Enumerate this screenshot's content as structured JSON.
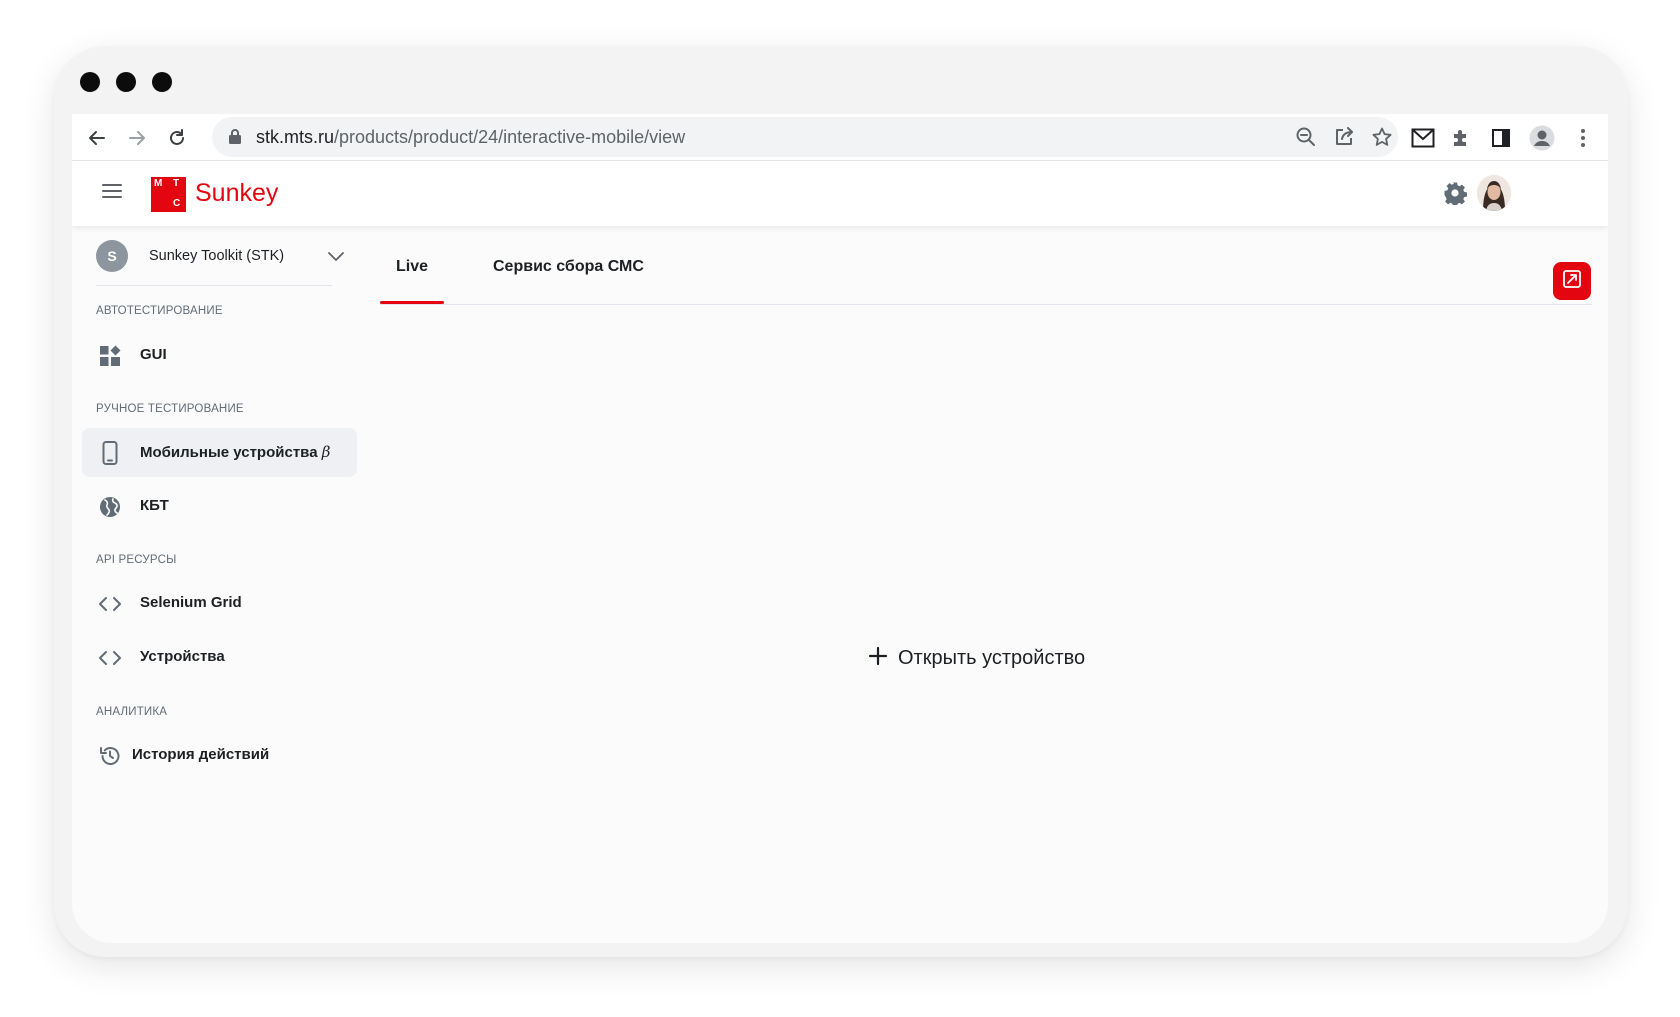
{
  "browser": {
    "url_host": "stk.mts.ru",
    "url_path": "/products/product/24/interactive-mobile/view"
  },
  "header": {
    "logo_letters": [
      "М",
      "Т",
      "С"
    ],
    "brand": "Sunkey",
    "brand_color": "#e30611"
  },
  "sidebar": {
    "project": {
      "avatar_letter": "S",
      "name": "Sunkey Toolkit (STK)"
    },
    "sections": [
      {
        "label": "АВТОТЕСТИРОВАНИЕ",
        "items": [
          {
            "label": "GUI",
            "icon": "dashboard-icon"
          }
        ]
      },
      {
        "label": "РУЧНОЕ ТЕСТИРОВАНИЕ",
        "items": [
          {
            "label": "Мобильные устройства",
            "badge": "β",
            "icon": "smartphone-icon",
            "active": true
          },
          {
            "label": "КБТ",
            "icon": "globe-icon"
          }
        ]
      },
      {
        "label": "API РЕСУРСЫ",
        "items": [
          {
            "label": "Selenium Grid",
            "icon": "code-icon"
          },
          {
            "label": "Устройства",
            "icon": "code-icon"
          }
        ]
      },
      {
        "label": "АНАЛИТИКА",
        "items": [
          {
            "label": "История действий",
            "icon": "history-icon"
          }
        ]
      }
    ]
  },
  "tabs": [
    {
      "label": "Live",
      "active": true
    },
    {
      "label": "Сервис сбора СМС",
      "active": false
    }
  ],
  "main": {
    "open_device_label": "Открыть устройство"
  },
  "colors": {
    "accent": "#e30611",
    "active_bg": "#eef0f3"
  }
}
